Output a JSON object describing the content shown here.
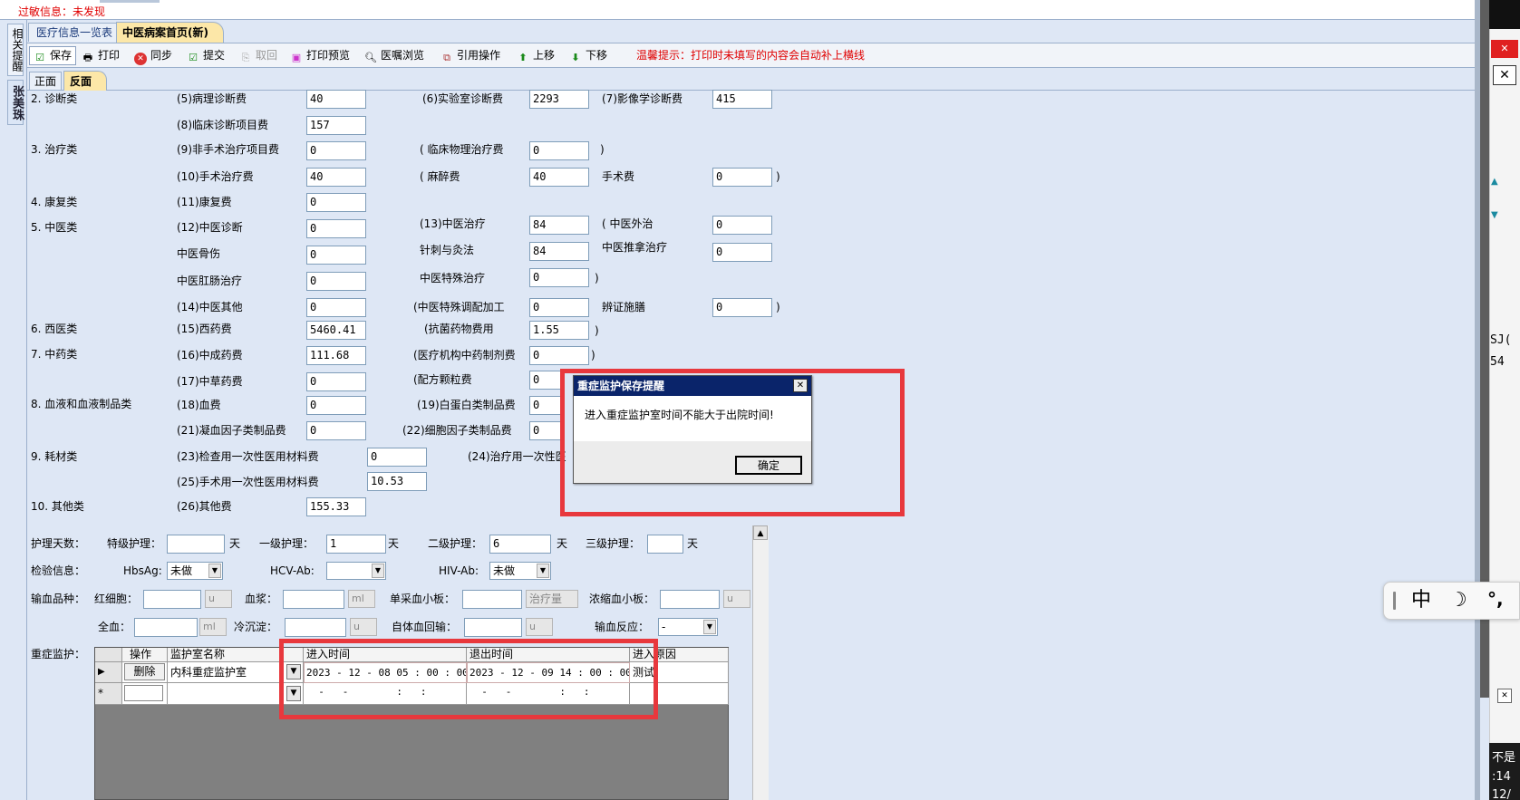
{
  "allergy": {
    "label": "过敏信息：未发现"
  },
  "side_tabs": {
    "reminder": "相关提醒",
    "patient_name": "张美珠"
  },
  "doc_tabs": [
    {
      "label": "医疗信息一览表"
    },
    {
      "label": "中医病案首页(新)"
    }
  ],
  "toolbar": {
    "save": "保存",
    "print": "打印",
    "sync": "同步",
    "submit": "提交",
    "retract": "取回",
    "print_preview": "打印预览",
    "orders_browse": "医嘱浏览",
    "quote_op": "引用操作",
    "move_up": "上移",
    "move_down": "下移",
    "tip": "温馨提示：打印时未填写的内容会自动补上横线"
  },
  "page_tabs": {
    "front": "正面",
    "back": "反面"
  },
  "fees": {
    "c2": "2. 诊断类",
    "c3": "3. 治疗类",
    "c4": "4. 康复类",
    "c5": "5. 中医类",
    "c6": "6. 西医类",
    "c7": "7. 中药类",
    "c8": "8. 血液和血液制品类",
    "c9": "9. 耗材类",
    "c10": "10. 其他类",
    "f5_label": "(5)病理诊断费",
    "f5": "40",
    "f6_label": "(6)实验室诊断费",
    "f6": "2293",
    "f7_label": "(7)影像学诊断费",
    "f7": "415",
    "f8_label": "(8)临床诊断项目费",
    "f8": "157",
    "f9_label": "(9)非手术治疗项目费",
    "f9": "0",
    "physio_label": "( 临床物理治疗费",
    "physio": "0",
    "f10_label": "(10)手术治疗费",
    "f10": "40",
    "anes_label": "( 麻醉费",
    "anes": "40",
    "surgery_label": "手术费",
    "surgery": "0",
    "f11_label": "(11)康复费",
    "f11": "0",
    "f12_label": "(12)中医诊断",
    "f12": "0",
    "f13_label": "(13)中医治疗",
    "f13": "84",
    "tcm_ext_label": "( 中医外治",
    "tcm_ext": "0",
    "bone_label": "中医骨伤",
    "bone": "0",
    "acu_label": "针刺与灸法",
    "acu": "84",
    "tuina_label": "中医推拿治疗",
    "tuina": "0",
    "anal_label": "中医肛肠治疗",
    "anal": "0",
    "special_label": "中医特殊治疗",
    "special": "0",
    "f14_label": "(14)中医其他",
    "f14": "0",
    "prep_label": "(中医特殊调配加工",
    "prep": "0",
    "diet_label": "辨证施膳",
    "diet": "0",
    "f15_label": "(15)西药费",
    "f15": "5460.41",
    "anti_label": "(抗菌药物费用",
    "anti": "1.55",
    "f16_label": "(16)中成药费",
    "f16": "111.68",
    "inst_label": "(医疗机构中药制剂费",
    "inst": "0",
    "f17_label": "(17)中草药费",
    "f17": "0",
    "granule_label": "(配方颗粒费",
    "granule": "0",
    "f18_label": "(18)血费",
    "f18": "0",
    "f19_label": "(19)白蛋白类制品费",
    "f19": "0",
    "f21_label": "(21)凝血因子类制品费",
    "f21": "0",
    "f22_label": "(22)细胞因子类制品费",
    "f22": "0",
    "f23_label": "(23)检查用一次性医用材料费",
    "f23": "0",
    "f24_label": "(24)治疗用一次性医",
    "f25_label": "(25)手术用一次性医用材料费",
    "f25": "10.53",
    "f26_label": "(26)其他费",
    "f26": "155.33"
  },
  "nursing": {
    "label": "护理天数：",
    "special_label": "特级护理：",
    "special": "",
    "l1_label": "一级护理：",
    "l1": "1",
    "l2_label": "二级护理：",
    "l2": "6",
    "l3_label": "三级护理：",
    "l3": "",
    "day": "天"
  },
  "tests": {
    "label": "检验信息：",
    "hbsag_label": "HbsAg:",
    "hbsag": "未做",
    "hcv_label": "HCV-Ab:",
    "hcv": "",
    "hiv_label": "HIV-Ab:",
    "hiv": "未做"
  },
  "transfusion": {
    "label": "输血品种：",
    "rbc_label": "红细胞：",
    "rbc_unit": "u",
    "plasma_label": "血浆：",
    "plasma_unit": "ml",
    "platelet_label": "单采血小板：",
    "platelet_unit": "治疗量",
    "conc_label": "浓缩血小板：",
    "conc_unit": "u",
    "whole_label": "全血：",
    "whole_unit": "ml",
    "cryo_label": "冷沉淀：",
    "cryo_unit": "u",
    "auto_label": "自体血回输：",
    "auto_unit": "u",
    "reaction_label": "输血反应：",
    "reaction": "-"
  },
  "icu": {
    "label": "重症监护：",
    "headers": [
      "操作",
      "监护室名称",
      "进入时间",
      "退出时间",
      "进入原因"
    ],
    "rows": [
      {
        "op": "删除",
        "room": "内科重症监护室",
        "enter": "2023 - 12 - 08   05 : 00 : 00",
        "exit": "2023 - 12 - 09   14 : 00 : 00",
        "reason": "测试"
      }
    ],
    "new_row": {
      "enter": "  -   -        :   :",
      "exit": "  -   -        :   :"
    }
  },
  "dialog": {
    "title": "重症监护保存提醒",
    "message": "进入重症监护室时间不能大于出院时间!",
    "ok": "确定",
    "close": "✕"
  },
  "right_edge": {
    "frag1": "SJ(",
    "frag2": "54",
    "frag3": "不是",
    "frag4": ":14",
    "frag5": "12/"
  },
  "ime": {
    "mode": "中",
    "moon": "☽",
    "punct": "°,"
  },
  "colors": {
    "highlight": "#e8383d",
    "tip": "#e00000"
  }
}
